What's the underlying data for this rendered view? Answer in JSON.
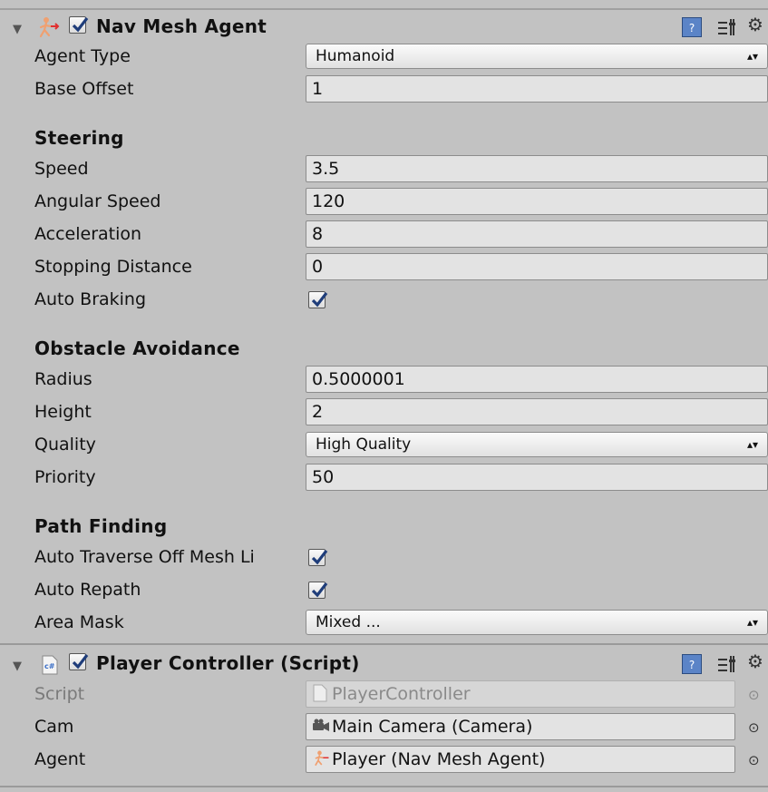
{
  "nav_mesh_agent": {
    "title": "Nav Mesh Agent",
    "enabled": true,
    "icons": {
      "component": "nav-mesh-agent-icon",
      "help": "help-icon",
      "presets": "presets-icon",
      "settings": "gear-icon"
    },
    "agent_type": {
      "label": "Agent Type",
      "value": "Humanoid"
    },
    "base_offset": {
      "label": "Base Offset",
      "value": "1"
    },
    "steering": {
      "title": "Steering",
      "speed": {
        "label": "Speed",
        "value": "3.5"
      },
      "angular_speed": {
        "label": "Angular Speed",
        "value": "120"
      },
      "acceleration": {
        "label": "Acceleration",
        "value": "8"
      },
      "stopping_distance": {
        "label": "Stopping Distance",
        "value": "0"
      },
      "auto_braking": {
        "label": "Auto Braking",
        "checked": true
      }
    },
    "obstacle_avoidance": {
      "title": "Obstacle Avoidance",
      "radius": {
        "label": "Radius",
        "value": "0.5000001"
      },
      "height": {
        "label": "Height",
        "value": "2"
      },
      "quality": {
        "label": "Quality",
        "value": "High Quality"
      },
      "priority": {
        "label": "Priority",
        "value": "50"
      }
    },
    "path_finding": {
      "title": "Path Finding",
      "auto_traverse": {
        "label": "Auto Traverse Off Mesh Li",
        "checked": true
      },
      "auto_repath": {
        "label": "Auto Repath",
        "checked": true
      },
      "area_mask": {
        "label": "Area Mask",
        "value": "Mixed ..."
      }
    }
  },
  "player_controller": {
    "title": "Player Controller (Script)",
    "enabled": true,
    "icons": {
      "component": "csharp-script-icon",
      "help": "help-icon",
      "presets": "presets-icon",
      "settings": "gear-icon"
    },
    "script": {
      "label": "Script",
      "value": "PlayerController"
    },
    "cam": {
      "label": "Cam",
      "value": "Main Camera (Camera)"
    },
    "agent": {
      "label": "Agent",
      "value": "Player (Nav Mesh Agent)"
    }
  },
  "colors": {
    "panel": "#c2c2c2",
    "field": "#e3e3e3",
    "checkmark": "#1f3d7a",
    "help": "#5b84c7"
  }
}
